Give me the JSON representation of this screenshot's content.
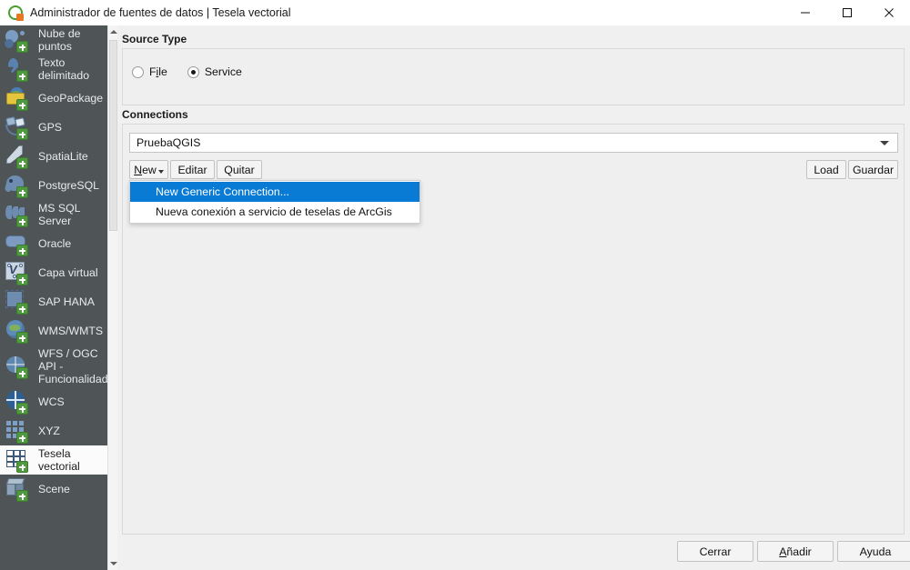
{
  "window": {
    "title": "Administrador de fuentes de datos | Tesela vectorial",
    "app_icon": "qgis-logo-icon",
    "controls": {
      "minimize": "minimize-icon",
      "maximize": "maximize-icon",
      "close": "close-icon"
    }
  },
  "sidebar": {
    "items": [
      {
        "label": "Nube de puntos",
        "icon": "point-cloud-icon",
        "selected": false
      },
      {
        "label": "Texto delimitado",
        "icon": "delimited-text-icon",
        "selected": false
      },
      {
        "label": "GeoPackage",
        "icon": "geopackage-icon",
        "selected": false
      },
      {
        "label": "GPS",
        "icon": "gps-icon",
        "selected": false
      },
      {
        "label": "SpatiaLite",
        "icon": "spatialite-icon",
        "selected": false
      },
      {
        "label": "PostgreSQL",
        "icon": "postgresql-icon",
        "selected": false
      },
      {
        "label": "MS SQL Server",
        "icon": "mssql-server-icon",
        "selected": false
      },
      {
        "label": "Oracle",
        "icon": "oracle-icon",
        "selected": false
      },
      {
        "label": "Capa virtual",
        "icon": "virtual-layer-icon",
        "selected": false
      },
      {
        "label": "SAP HANA",
        "icon": "sap-hana-icon",
        "selected": false
      },
      {
        "label": "WMS/WMTS",
        "icon": "wms-wmts-icon",
        "selected": false
      },
      {
        "label": "WFS / OGC API - Funcionalidad",
        "icon": "wfs-ogc-api-icon",
        "selected": false
      },
      {
        "label": "WCS",
        "icon": "wcs-icon",
        "selected": false
      },
      {
        "label": "XYZ",
        "icon": "xyz-icon",
        "selected": false
      },
      {
        "label": "Tesela vectorial",
        "icon": "vector-tile-icon",
        "selected": true
      },
      {
        "label": "Scene",
        "icon": "scene-icon",
        "selected": false
      }
    ],
    "scrollbar": {
      "up_arrow": "scroll-up-icon",
      "down_arrow": "scroll-down-icon"
    }
  },
  "source_type": {
    "title": "Source Type",
    "options": [
      {
        "label": "File",
        "mnemonic": "l",
        "selected": false
      },
      {
        "label": "Service",
        "mnemonic": "",
        "selected": true
      }
    ]
  },
  "connections": {
    "title": "Connections",
    "selected_connection": "PruebaQGIS",
    "dropdown_icon": "chevron-down-icon",
    "buttons": {
      "new": "New",
      "new_mnemonic": "N",
      "new_has_menu": true,
      "edit": "Editar",
      "remove": "Quitar",
      "load": "Load",
      "save": "Guardar"
    },
    "menu": {
      "open": true,
      "items": [
        {
          "label": "New Generic Connection...",
          "highlighted": true
        },
        {
          "label": "Nueva conexión a servicio de teselas de ArcGis",
          "highlighted": false
        }
      ]
    }
  },
  "footer": {
    "close": "Cerrar",
    "add": "Añadir",
    "add_mnemonic": "A",
    "help": "Ayuda"
  },
  "colors": {
    "sidebar_bg": "#4f5457",
    "selection_blue": "#0a7bd4",
    "panel_bg": "#f0f0f0",
    "badge_green": "#4f9a3f"
  }
}
